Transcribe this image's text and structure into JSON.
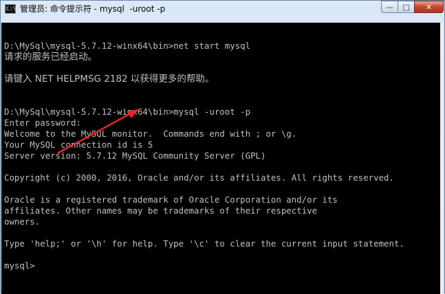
{
  "window": {
    "title": "管理员: 命令提示符 - mysql  -uroot -p",
    "icon": "cmd-icon",
    "controls": {
      "minimize": "—",
      "maximize": "□",
      "close": "✕"
    }
  },
  "console": {
    "lines": [
      "",
      "D:\\MySql\\mysql-5.7.12-winx64\\bin>net start mysql",
      "请求的服务已经启动。",
      "",
      "请键入 NET HELPMSG 2182 以获得更多的帮助。",
      "",
      "",
      "D:\\MySql\\mysql-5.7.12-winx64\\bin>mysql -uroot -p",
      "Enter password:",
      "Welcome to the MySQL monitor.  Commands end with ; or \\g.",
      "Your MySQL connection id is 5",
      "Server version: 5.7.12 MySQL Community Server (GPL)",
      "",
      "Copyright (c) 2000, 2016, Oracle and/or its affiliates. All rights reserved.",
      "",
      "Oracle is a registered trademark of Oracle Corporation and/or its",
      "affiliates. Other names may be trademarks of their respective",
      "owners.",
      "",
      "Type 'help;' or '\\h' for help. Type '\\c' to clear the current input statement.",
      "",
      "mysql>"
    ],
    "cjk_lines": [
      2,
      4
    ],
    "background": "#000000",
    "foreground": "#c0c0c0",
    "annotation_color": "#e8262a"
  }
}
